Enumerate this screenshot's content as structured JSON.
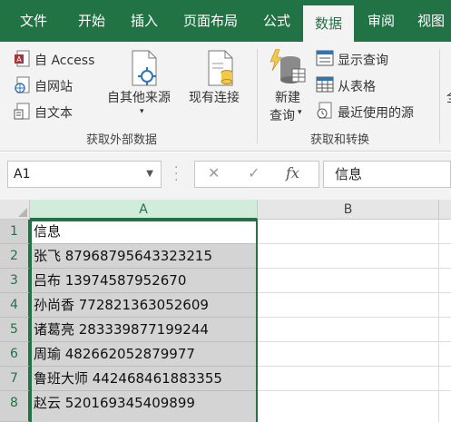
{
  "tabs": [
    "文件",
    "开始",
    "插入",
    "页面布局",
    "公式",
    "数据",
    "审阅",
    "视图"
  ],
  "active_tab": "数据",
  "ribbon": {
    "from_access": "自 Access",
    "from_web": "自网站",
    "from_text": "自文本",
    "from_other": "自其他来源",
    "existing": "现有连接",
    "group1_label": "获取外部数据",
    "new_query_1": "新建",
    "new_query_2": "查询",
    "show_queries": "显示查询",
    "from_table": "从表格",
    "recent_sources": "最近使用的源",
    "group2_label": "获取和转换",
    "overflow_glyph": "全"
  },
  "formula_bar": {
    "name_box": "A1",
    "cancel_glyph": "✕",
    "enter_glyph": "✓",
    "fx_glyph": "fx",
    "value": "信息"
  },
  "columns": [
    "A",
    "B"
  ],
  "rows": [
    {
      "num": "1",
      "a": "信息"
    },
    {
      "num": "2",
      "a": "张飞 87968795643323215"
    },
    {
      "num": "3",
      "a": "吕布 13974587952670"
    },
    {
      "num": "4",
      "a": "孙尚香 772821363052609"
    },
    {
      "num": "5",
      "a": "诸葛亮 283339877199244"
    },
    {
      "num": "6",
      "a": "周瑜 482662052879977"
    },
    {
      "num": "7",
      "a": "鲁班大师 442468461883355"
    },
    {
      "num": "8",
      "a": "赵云 520169345409899"
    }
  ],
  "colors": {
    "excel_green": "#217346",
    "selection_fill": "#d4d4d4"
  }
}
